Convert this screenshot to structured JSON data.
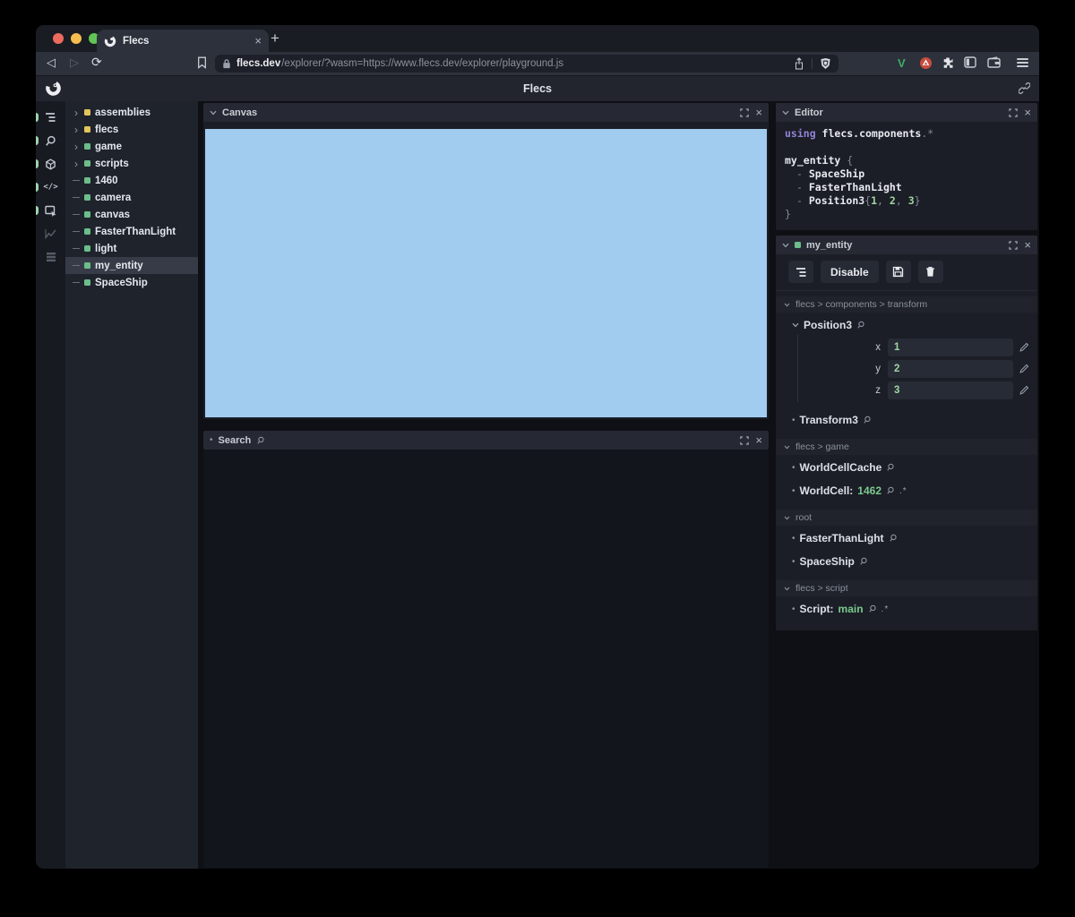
{
  "glyphs": {
    "close": "×",
    "plus": "+",
    "expand_caret": "›",
    "bullet": "•",
    "code_icon": "</>",
    "back": "◁",
    "forward": "▷",
    "reload": "⟳"
  },
  "browser": {
    "tab_title": "Flecs",
    "url_domain": "flecs.dev",
    "url_path": "/explorer/?wasm=https://www.flecs.dev/explorer/playground.js",
    "extension_v_label": "V"
  },
  "header": {
    "title": "Flecs"
  },
  "sidebar": {
    "items": [
      {
        "label": "assemblies",
        "type": "module",
        "color": "#e3c55c"
      },
      {
        "label": "flecs",
        "type": "module",
        "color": "#e3c55c"
      },
      {
        "label": "game",
        "type": "module",
        "color": "#6cbd8a"
      },
      {
        "label": "scripts",
        "type": "module",
        "color": "#6cbd8a"
      },
      {
        "label": "1460",
        "type": "entity",
        "color": "#6cbd8a"
      },
      {
        "label": "camera",
        "type": "entity",
        "color": "#6cbd8a"
      },
      {
        "label": "canvas",
        "type": "entity",
        "color": "#6cbd8a"
      },
      {
        "label": "FasterThanLight",
        "type": "entity",
        "color": "#6cbd8a"
      },
      {
        "label": "light",
        "type": "entity",
        "color": "#6cbd8a"
      },
      {
        "label": "my_entity",
        "type": "entity",
        "color": "#6cbd8a",
        "selected": true
      },
      {
        "label": "SpaceShip",
        "type": "entity",
        "color": "#6cbd8a"
      }
    ]
  },
  "panels": {
    "canvas": {
      "title": "Canvas"
    },
    "search": {
      "title": "Search"
    },
    "editor": {
      "title": "Editor"
    },
    "inspector": {
      "title": "my_entity",
      "disable_label": "Disable"
    }
  },
  "editor_code": {
    "l1_kw": "using ",
    "l1_id": "flecs.components",
    "l1_tail": ".*",
    "l3_id": "my_entity ",
    "l3_pun": "{",
    "l4_pun": "- ",
    "l4_id": "SpaceShip",
    "l5_pun": "- ",
    "l5_id": "FasterThanLight",
    "l6_pun": "- ",
    "l6_id": "Position3",
    "l6_open": "{",
    "l6_n1": "1",
    "l6_c1": ", ",
    "l6_n2": "2",
    "l6_c2": ", ",
    "l6_n3": "3",
    "l6_close": "}",
    "l7_pun": "}"
  },
  "inspector": {
    "sections": {
      "transform": {
        "title": "flecs > components > transform",
        "position3": {
          "name": "Position3",
          "fields": [
            {
              "label": "x",
              "value": "1"
            },
            {
              "label": "y",
              "value": "2"
            },
            {
              "label": "z",
              "value": "3"
            }
          ]
        },
        "transform3": {
          "name": "Transform3"
        }
      },
      "game": {
        "title": "flecs > game",
        "row1": {
          "name": "WorldCellCache"
        },
        "row2": {
          "name": "WorldCell:",
          "value": "1462",
          "pair": ".*"
        }
      },
      "root": {
        "title": "root",
        "row1": {
          "name": "FasterThanLight"
        },
        "row2": {
          "name": "SpaceShip"
        }
      },
      "script": {
        "title": "flecs > script",
        "row1": {
          "name": "Script:",
          "value": "main",
          "pair": ".*"
        }
      }
    }
  },
  "colors": {
    "canvas_blue": "#a2cbf0",
    "value_green": "#7cc98f",
    "module_yellow": "#e3c55c",
    "entity_green": "#6cbd8a",
    "traffic_red": "#ee6a5f",
    "traffic_yellow": "#f5bd4f",
    "traffic_green": "#61c454"
  }
}
